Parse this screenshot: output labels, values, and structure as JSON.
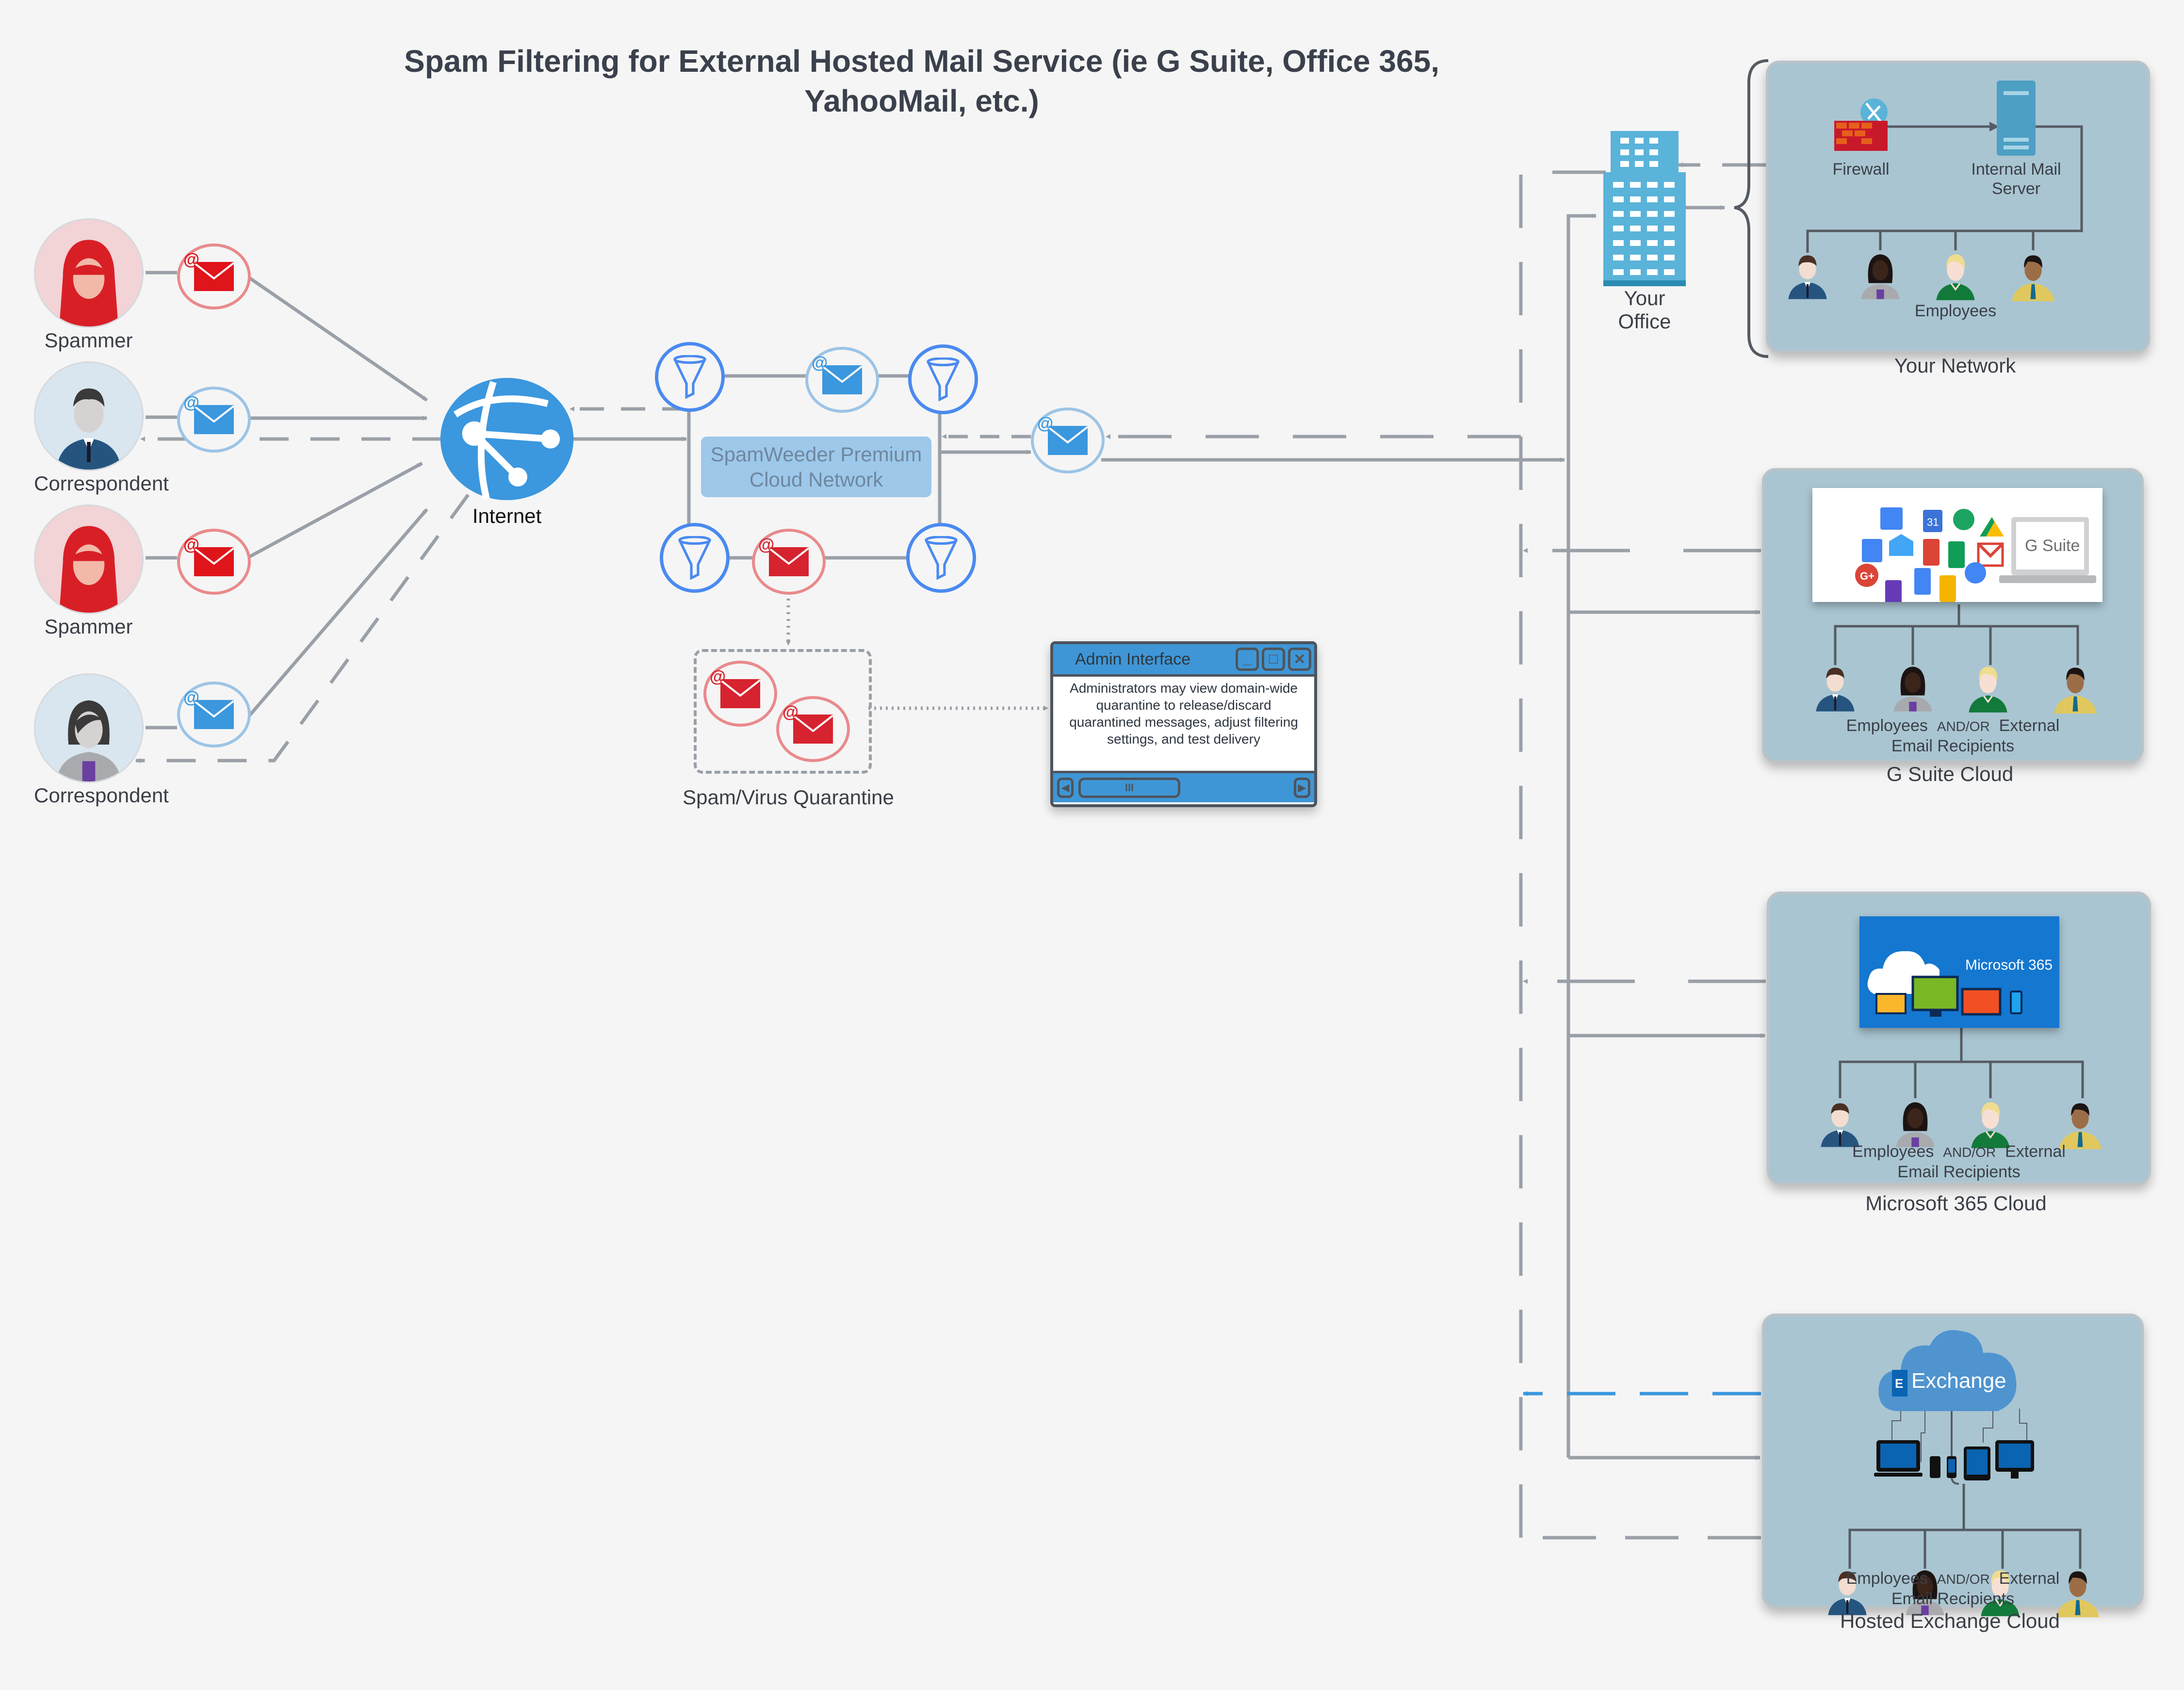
{
  "title": {
    "line1": "Spam Filtering for External Hosted Mail Service (ie G Suite, Office 365,",
    "line2": "YahooMail, etc.)"
  },
  "senders": [
    {
      "role": "spammer",
      "label": "Spammer",
      "mail": "spam"
    },
    {
      "role": "correspondent",
      "label": "Correspondent",
      "mail": "legit"
    },
    {
      "role": "spammer",
      "label": "Spammer",
      "mail": "spam"
    },
    {
      "role": "correspondent",
      "label": "Correspondent",
      "mail": "legit"
    }
  ],
  "internet": {
    "label": "Internet"
  },
  "spamweeder": {
    "line1": "SpamWeeder Premium",
    "line2": "Cloud Network"
  },
  "quarantine": {
    "label": "Spam/Virus Quarantine"
  },
  "admin": {
    "title": "Admin Interface",
    "buttons": {
      "minimize": "_",
      "maximize": "□",
      "close": "✕"
    },
    "description": "Administrators may view domain-wide quarantine to release/discard quarantined messages, adjust filtering settings, and test delivery",
    "scroll_left": "◀",
    "scroll_thumb": "III",
    "scroll_right": "▶"
  },
  "office": {
    "line1": "Your",
    "line2": "Office"
  },
  "your_network": {
    "label": "Your Network",
    "firewall": "Firewall",
    "mail_server_line1": "Internal Mail",
    "mail_server_line2": "Server",
    "employees": "Employees"
  },
  "gsuite": {
    "label": "G Suite Cloud",
    "logo_text": "G Suite",
    "recipients_line1_a": "Employees",
    "recipients_andor": "AND/OR",
    "recipients_line1_b": "External",
    "recipients_line2": "Email Recipients"
  },
  "microsoft365": {
    "label": "Microsoft 365 Cloud",
    "logo_text": "Microsoft 365",
    "recipients_line1_a": "Employees",
    "recipients_andor": "AND/OR",
    "recipients_line1_b": "External",
    "recipients_line2": "Email Recipients"
  },
  "exchange": {
    "label": "Hosted Exchange Cloud",
    "logo_text": "Exchange",
    "recipients_line1_a": "Employees",
    "recipients_andor": "AND/OR",
    "recipients_line1_b": "External",
    "recipients_line2": "Email Recipients"
  },
  "colors": {
    "spam_red": "#e0141b",
    "legit_blue": "#3b97de",
    "filter_blue": "#4a8af0",
    "connector_gray": "#9aa0a8",
    "panel_fill": "#a9c5d1",
    "exchange_dashed": "#3b97de"
  }
}
